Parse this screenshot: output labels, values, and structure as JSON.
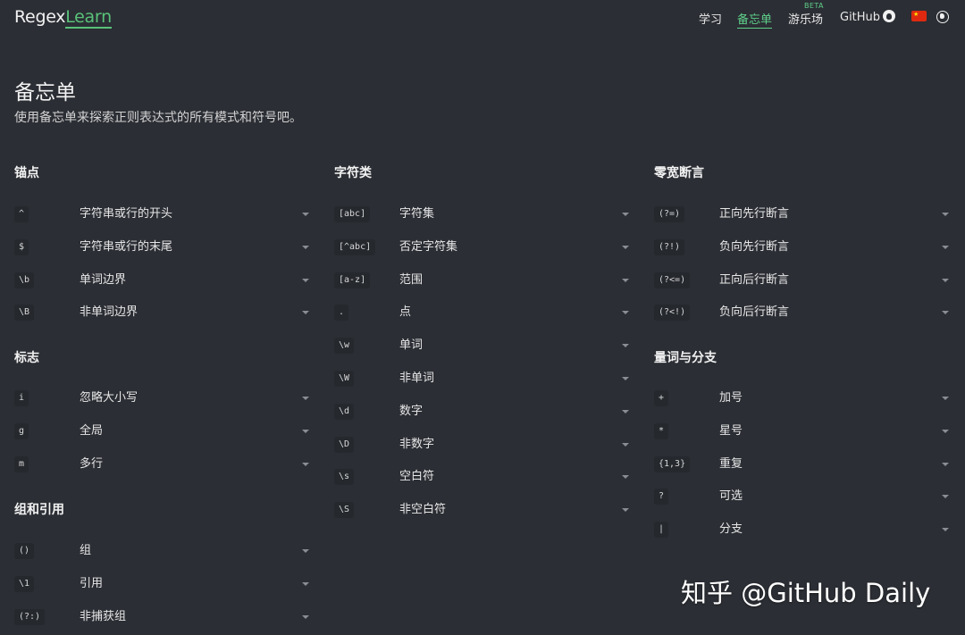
{
  "header": {
    "logo_part1": "Regex",
    "logo_part2": "Learn",
    "nav": {
      "learn": "学习",
      "cheatsheet": "备忘单",
      "playground": "游乐场",
      "beta": "BETA",
      "github": "GitHub"
    }
  },
  "page": {
    "title": "备忘单",
    "subtitle": "使用备忘单来探索正则表达式的所有模式和符号吧。"
  },
  "sections": {
    "anchors": {
      "title": "锚点",
      "items": [
        {
          "code": "^",
          "desc": "字符串或行的开头"
        },
        {
          "code": "$",
          "desc": "字符串或行的末尾"
        },
        {
          "code": "\\b",
          "desc": "单词边界"
        },
        {
          "code": "\\B",
          "desc": "非单词边界"
        }
      ]
    },
    "flags": {
      "title": "标志",
      "items": [
        {
          "code": "i",
          "desc": "忽略大小写"
        },
        {
          "code": "g",
          "desc": "全局"
        },
        {
          "code": "m",
          "desc": "多行"
        }
      ]
    },
    "groups": {
      "title": "组和引用",
      "items": [
        {
          "code": "()",
          "desc": "组"
        },
        {
          "code": "\\1",
          "desc": "引用"
        },
        {
          "code": "(?:)",
          "desc": "非捕获组"
        }
      ]
    },
    "charclasses": {
      "title": "字符类",
      "items": [
        {
          "code": "[abc]",
          "desc": "字符集"
        },
        {
          "code": "[^abc]",
          "desc": "否定字符集"
        },
        {
          "code": "[a-z]",
          "desc": "范围"
        },
        {
          "code": ".",
          "desc": "点"
        },
        {
          "code": "\\w",
          "desc": "单词"
        },
        {
          "code": "\\W",
          "desc": "非单词"
        },
        {
          "code": "\\d",
          "desc": "数字"
        },
        {
          "code": "\\D",
          "desc": "非数字"
        },
        {
          "code": "\\s",
          "desc": "空白符"
        },
        {
          "code": "\\S",
          "desc": "非空白符"
        }
      ]
    },
    "lookarounds": {
      "title": "零宽断言",
      "items": [
        {
          "code": "(?=)",
          "desc": "正向先行断言"
        },
        {
          "code": "(?!)",
          "desc": "负向先行断言"
        },
        {
          "code": "(?<=)",
          "desc": "正向后行断言"
        },
        {
          "code": "(?<!)",
          "desc": "负向后行断言"
        }
      ]
    },
    "quantifiers": {
      "title": "量词与分支",
      "items": [
        {
          "code": "+",
          "desc": "加号"
        },
        {
          "code": "*",
          "desc": "星号"
        },
        {
          "code": "{1,3}",
          "desc": "重复"
        },
        {
          "code": "?",
          "desc": "可选"
        },
        {
          "code": "|",
          "desc": "分支"
        }
      ]
    }
  },
  "watermark": "知乎 @GitHub Daily",
  "colors": {
    "background": "#2b2e34",
    "accent": "#59c27a",
    "code_bg": "#25282d"
  }
}
